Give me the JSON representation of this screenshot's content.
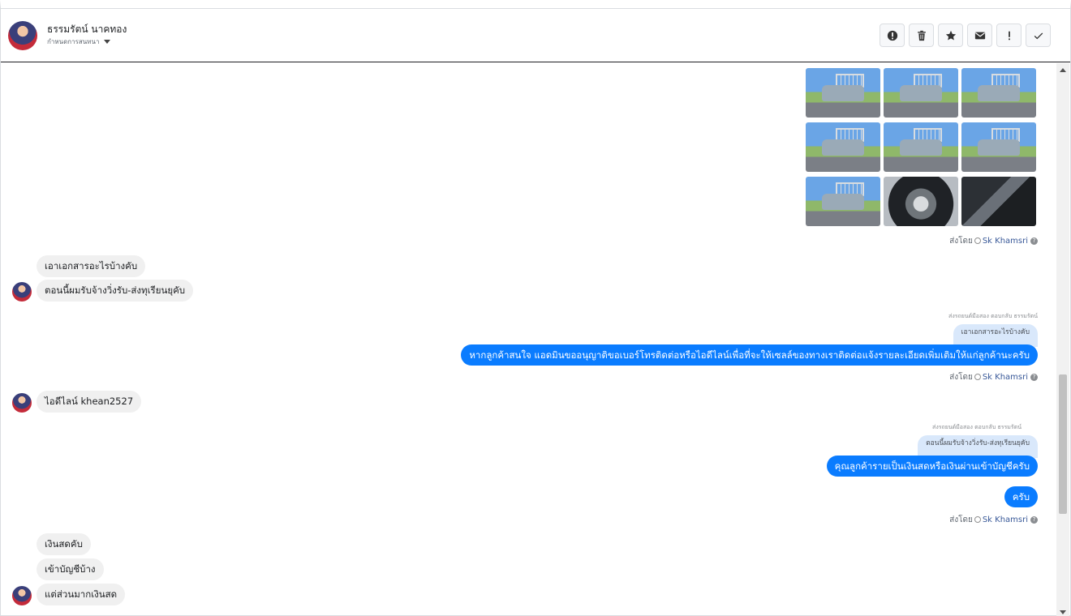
{
  "header": {
    "name": "ธรรมรัตน์ นาคทอง",
    "subtitle": "กำหนดการสนทนา"
  },
  "toolbar": {
    "buttons": [
      {
        "icon": "alert-circle-icon"
      },
      {
        "icon": "trash-icon"
      },
      {
        "icon": "star-icon"
      },
      {
        "icon": "envelope-icon"
      },
      {
        "icon": "exclamation-icon"
      },
      {
        "icon": "check-icon"
      }
    ]
  },
  "gallery": {
    "photos": [
      "car-side",
      "car-front",
      "car-angle",
      "car-rear-left",
      "car-rear",
      "car-rear-right",
      "car-side-left",
      "wheel",
      "interior"
    ]
  },
  "sent_by": {
    "label": "ส่งโดย",
    "who": "Sk Khamsri"
  },
  "messages": {
    "in1": "เอาเอกสารอะไรบ้างคับ",
    "in2": "ตอนนี้ผมรับจ้างวิ่งรับ-ส่งทุเรียนยุคับ",
    "reply1_note": "ส่งรถยนต์มือสอง ตอบกลับ ธรรมรัตน์",
    "reply1_quote": "เอาเอกสารอะไรบ้างคับ",
    "out1": "หากลูกค้าสนใจ แอดมินขออนุญาติขอเบอร์โทรติดต่อหรือไอดีไลน์เพื่อที่จะให้เซลล์ของทางเราติดต่อแจ้งรายละเอียดเพิ่มเติมให้แก่ลูกค้านะครับ",
    "in3": "ไอดีไลน์ khean2527",
    "reply2_note": "ส่งรถยนต์มือสอง ตอบกลับ ธรรมรัตน์",
    "reply2_quote": "ตอนนี้ผมรับจ้างวิ่งรับ-ส่งทุเรียนยุคับ",
    "out2": "คุณลูกค้ารายเป็นเงินสดหรือเงินผ่านเข้าบัญชีครับ",
    "out3": "ครับ",
    "in4": "เงินสดคับ",
    "in5": "เข้าบัญชีบ้าง",
    "in6": "แต่ส่วนมากเงินสด"
  },
  "colors": {
    "outgoing": "#0a7cff",
    "incoming": "#f0f0f0",
    "quote": "#d9e8fb",
    "link": "#385898"
  }
}
